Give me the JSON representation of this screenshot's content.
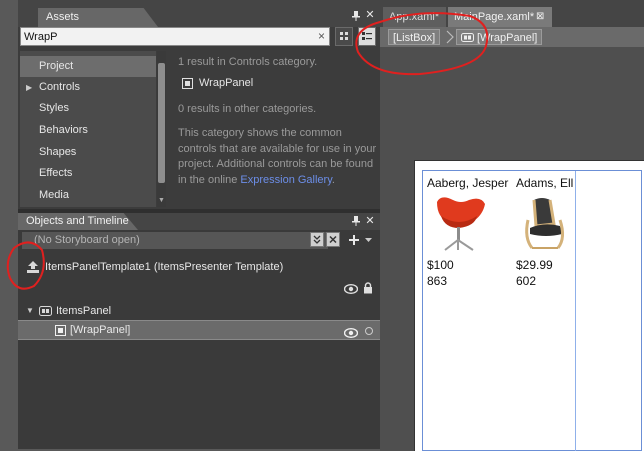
{
  "assets_panel": {
    "tab_label": "Assets",
    "search": {
      "value": "WrapP",
      "clear_glyph": "×"
    },
    "categories": [
      {
        "label": "Project",
        "selected": true,
        "expandable": false
      },
      {
        "label": "Controls",
        "selected": false,
        "expandable": true
      },
      {
        "label": "Styles",
        "selected": false,
        "expandable": false
      },
      {
        "label": "Behaviors",
        "selected": false,
        "expandable": false
      },
      {
        "label": "Shapes",
        "selected": false,
        "expandable": false
      },
      {
        "label": "Effects",
        "selected": false,
        "expandable": false
      },
      {
        "label": "Media",
        "selected": false,
        "expandable": false
      }
    ],
    "results": {
      "header": "1 result in Controls category.",
      "item": "WrapPanel",
      "other": "0 results in other categories.",
      "desc_lines": [
        "This category shows the common",
        "controls that are available for use in your",
        "project. Additional controls can be found"
      ],
      "desc_last_prefix": "in the online ",
      "desc_link": "Expression Gallery",
      "desc_last_suffix": "."
    }
  },
  "objects_panel": {
    "tab_label": "Objects and Timeline",
    "storyboard": "(No Storyboard open)",
    "template_label": "ItemsPanelTemplate1 (ItemsPresenter Template)",
    "tree": [
      {
        "label": "ItemsPanel",
        "selected": false,
        "expanded": true
      },
      {
        "label": "[WrapPanel]",
        "selected": true,
        "expanded": false
      }
    ]
  },
  "document": {
    "tabs": [
      {
        "label": "App.xaml*",
        "active": false
      },
      {
        "label": "MainPage.xaml*",
        "active": true
      }
    ],
    "close_glyph": "⊠",
    "breadcrumb": [
      {
        "label": "[ListBox]"
      },
      {
        "label": "[WrapPanel]"
      }
    ]
  },
  "design": {
    "products": [
      {
        "name": "Aaberg, Jesper",
        "price": "$100",
        "number": "863",
        "image": "red-swan-chair"
      },
      {
        "name": "Adams, Ell",
        "price": "$29.99",
        "number": "602",
        "image": "bentwood-armchair"
      }
    ]
  },
  "colors": {
    "panel_dark": "#3c3c3c",
    "annotation_red": "#e0201f",
    "link_blue": "#6c8ee8",
    "selection_blue": "#6b8fd6"
  }
}
